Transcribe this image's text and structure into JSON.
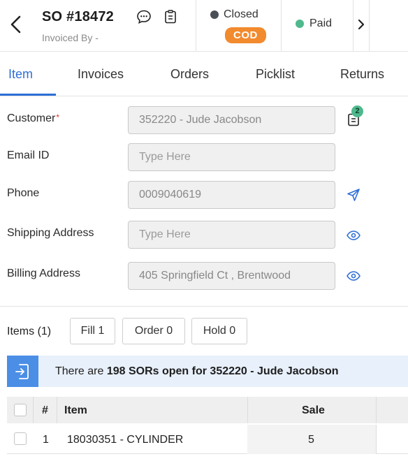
{
  "header": {
    "title": "SO #18472",
    "subtitle": "Invoiced By -",
    "status": {
      "label": "Closed",
      "dot_color": "#4a4f57"
    },
    "payment_type": "COD",
    "payment_status": {
      "label": "Paid",
      "dot_color": "#4fb88c"
    },
    "icons": [
      "back-chevron-icon",
      "chat-icon",
      "clipboard-icon",
      "chevron-right-icon"
    ]
  },
  "tabs": [
    {
      "label": "Item",
      "active": true
    },
    {
      "label": "Invoices",
      "active": false
    },
    {
      "label": "Orders",
      "active": false
    },
    {
      "label": "Picklist",
      "active": false
    },
    {
      "label": "Returns",
      "active": false
    }
  ],
  "form": {
    "customer": {
      "label": "Customer",
      "required_mark": "*",
      "value": "352220 - Jude Jacobson",
      "badge": "2"
    },
    "email": {
      "label": "Email ID",
      "placeholder": "Type Here",
      "value": ""
    },
    "phone": {
      "label": "Phone",
      "value": "0009040619"
    },
    "shipping": {
      "label": "Shipping Address",
      "placeholder": "Type Here",
      "value": ""
    },
    "billing": {
      "label": "Billing Address",
      "value": "405 Springfield Ct , Brentwood"
    }
  },
  "items_bar": {
    "label": "Items (1)",
    "fill": "Fill  1",
    "order": "Order  0",
    "hold": "Hold  0"
  },
  "banner": {
    "prefix": "There are ",
    "count": "198",
    "suffix": " SORs open for 352220 - Jude Jacobson"
  },
  "table": {
    "columns": [
      "#",
      "Item",
      "Sale"
    ],
    "rows": [
      {
        "num": "1",
        "item": "18030351 - CYLINDER",
        "sale": "5"
      }
    ]
  },
  "colors": {
    "accent": "#2d6fd6",
    "cod": "#f28a2e",
    "banner_bg": "#e8f0fb",
    "banner_icon": "#4b8ee6"
  }
}
